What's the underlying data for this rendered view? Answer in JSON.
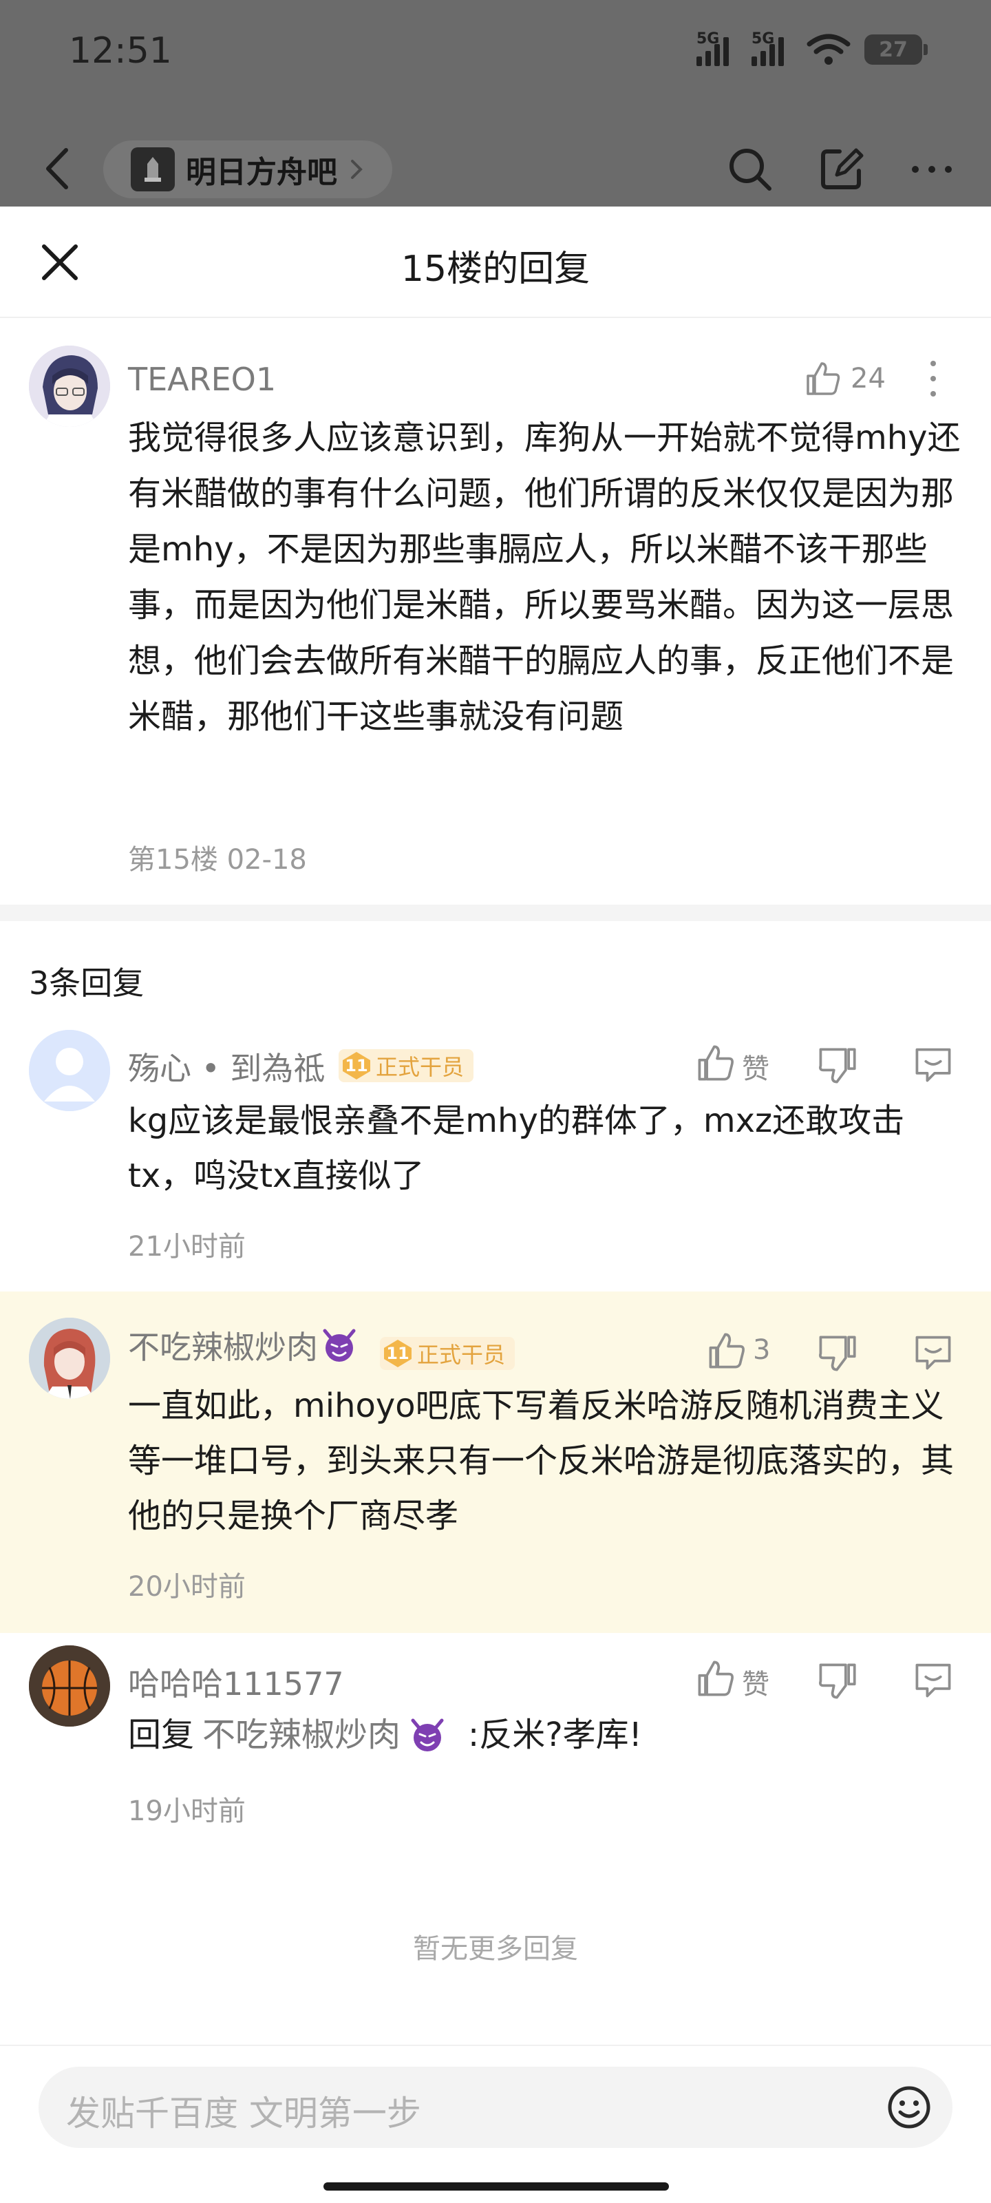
{
  "status_bar": {
    "time": "12:51",
    "net1": "5G",
    "net2": "5G",
    "battery": "27"
  },
  "nav": {
    "forum_name": "明日方舟吧"
  },
  "sheet": {
    "title": "15楼的回复",
    "close_label": ""
  },
  "main_post": {
    "username": "TEAREO1",
    "likes": "24",
    "text": "我觉得很多人应该意识到，库狗从一开始就不觉得mhy还有米醋做的事有什么问题，他们所谓的反米仅仅是因为那是mhy，不是因为那些事膈应人，所以米醋不该干那些事，而是因为他们是米醋，所以要骂米醋。因为这一层思想，他们会去做所有米醋干的膈应人的事，反正他们不是米醋，那他们干这些事就没有问题",
    "floor_date": "第15楼 02-18"
  },
  "replies_count": "3条回复",
  "replies": [
    {
      "username": "殇心 • 到為祗",
      "badge_level": "11",
      "badge_text": "正式干员",
      "like_label": "赞",
      "text": "kg应该是最恨亲叠不是mhy的群体了，mxz还敢攻击tx，鸣没tx直接似了",
      "time": "21小时前"
    },
    {
      "username": "不吃辣椒炒肉",
      "badge_level": "11",
      "badge_text": "正式干员",
      "like_label": "3",
      "text": "一直如此，mihoyo吧底下写着反米哈游反随机消费主义等一堆口号，到头来只有一个反米哈游是彻底落实的，其他的只是换个厂商尽孝",
      "time": "20小时前"
    },
    {
      "username": "哈哈哈111577",
      "like_label": "赞",
      "reply_prefix": "回复",
      "reply_to": "不吃辣椒炒肉",
      "text": ":反米?孝库!",
      "time": "19小时前"
    }
  ],
  "no_more": "暂无更多回复",
  "input": {
    "placeholder": "发贴千百度 文明第一步"
  },
  "colors": {
    "highlight_bg": "#fdf9e5",
    "badge_gold": "#f3b649",
    "devil_purple": "#7e3fb2"
  }
}
